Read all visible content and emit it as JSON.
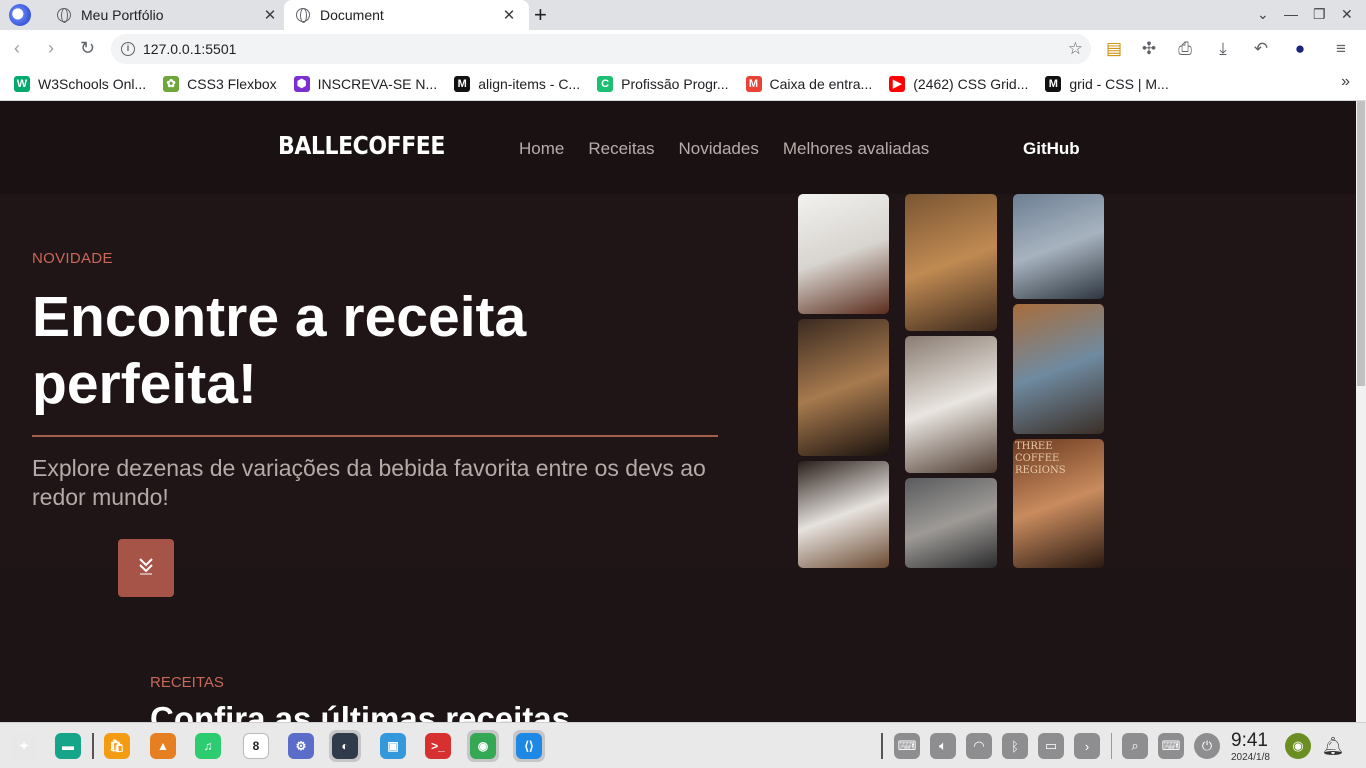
{
  "browser": {
    "tabs": [
      {
        "title": "Meu Portfólio",
        "active": false
      },
      {
        "title": "Document",
        "active": true
      }
    ],
    "new_tab_glyph": "+",
    "address": "127.0.0.1:5501",
    "bookmarks": [
      {
        "label": "W3Schools Onl...",
        "icon": "w3schools-icon",
        "color": "#04aa6d",
        "glyph": "W"
      },
      {
        "label": "CSS3 Flexbox",
        "icon": "flexbox-icon",
        "color": "#6ea63b",
        "glyph": "✿"
      },
      {
        "label": "INSCREVA-SE N...",
        "icon": "hexagon-icon",
        "color": "#7b2fd1",
        "glyph": "⬢"
      },
      {
        "label": "align-items - C...",
        "icon": "mdn-icon",
        "color": "#111111",
        "glyph": "M"
      },
      {
        "label": "Profissão Progr...",
        "icon": "alura-icon",
        "color": "#1dbf73",
        "glyph": "C"
      },
      {
        "label": "Caixa de entra...",
        "icon": "gmail-icon",
        "color": "#ea4335",
        "glyph": "M"
      },
      {
        "label": "(2462) CSS Grid...",
        "icon": "youtube-icon",
        "color": "#ff0000",
        "glyph": "▶"
      },
      {
        "label": "grid - CSS | M...",
        "icon": "mdn-icon",
        "color": "#111111",
        "glyph": "M"
      }
    ]
  },
  "site": {
    "logo": "BALLECOFFEE",
    "nav": [
      "Home",
      "Receitas",
      "Novidades",
      "Melhores avaliadas"
    ],
    "github": "GitHub",
    "hero": {
      "eyebrow": "NOVIDADE",
      "title": "Encontre a receita perfeita!",
      "subtitle": "Explore dezenas de variações da bebida favorita entre os devs ao redor mundo!"
    },
    "section": {
      "eyebrow": "RECEITAS",
      "title": "Confira as últimas receitas"
    },
    "photos": [
      {
        "name": "photo-coffee-pour",
        "colors": [
          "#f2f2f0",
          "#d8d4cf",
          "#5a2c1c"
        ]
      },
      {
        "name": "photo-cafe-table",
        "colors": [
          "#7a5533",
          "#c08a52",
          "#3d2a1d"
        ]
      },
      {
        "name": "photo-man-laptop",
        "colors": [
          "#6d7f94",
          "#a7b3bf",
          "#2d3640"
        ]
      },
      {
        "name": "photo-latte-art",
        "colors": [
          "#3b2a20",
          "#a77a4e",
          "#1a120e"
        ]
      },
      {
        "name": "photo-steaming-mug",
        "colors": [
          "#8a7c72",
          "#e9e5e0",
          "#4e3b30"
        ]
      },
      {
        "name": "photo-coworking",
        "colors": [
          "#a86d3c",
          "#6f8aa0",
          "#3a2e26"
        ]
      },
      {
        "name": "photo-espresso-cup",
        "colors": [
          "#2a1f1a",
          "#e6e2de",
          "#6b4a32"
        ]
      },
      {
        "name": "photo-baristas",
        "colors": [
          "#5a5b5e",
          "#9d9a96",
          "#2b2b2d"
        ]
      },
      {
        "name": "photo-woman-cup",
        "colors": [
          "#6b3a20",
          "#c98b5e",
          "#2a1a12"
        ]
      }
    ],
    "photo_sign_text": "THREE COFFEE REGIONS"
  },
  "taskbar": {
    "apps": [
      {
        "icon": "launcher-icon",
        "color": "#e8e8e8"
      },
      {
        "icon": "terminal-app-icon",
        "color": "#17a589"
      },
      {
        "icon": "store-icon",
        "color": "#f39c12"
      },
      {
        "icon": "photos-icon",
        "color": "#e67e22"
      },
      {
        "icon": "music-icon",
        "color": "#2ecc71"
      },
      {
        "icon": "calendar-icon",
        "color": "#ffffff"
      },
      {
        "icon": "settings-icon",
        "color": "#5b6dc8"
      },
      {
        "icon": "browser-app-icon",
        "color": "#2f3a4a"
      },
      {
        "icon": "appstore-icon",
        "color": "#3498db"
      },
      {
        "icon": "console-icon",
        "color": "#d63031"
      },
      {
        "icon": "chrome-icon",
        "color": "#34a853"
      },
      {
        "icon": "vscode-icon",
        "color": "#1e88e5"
      }
    ],
    "calendar_day": "8",
    "time": "9:41",
    "date": "2024/1/8"
  }
}
